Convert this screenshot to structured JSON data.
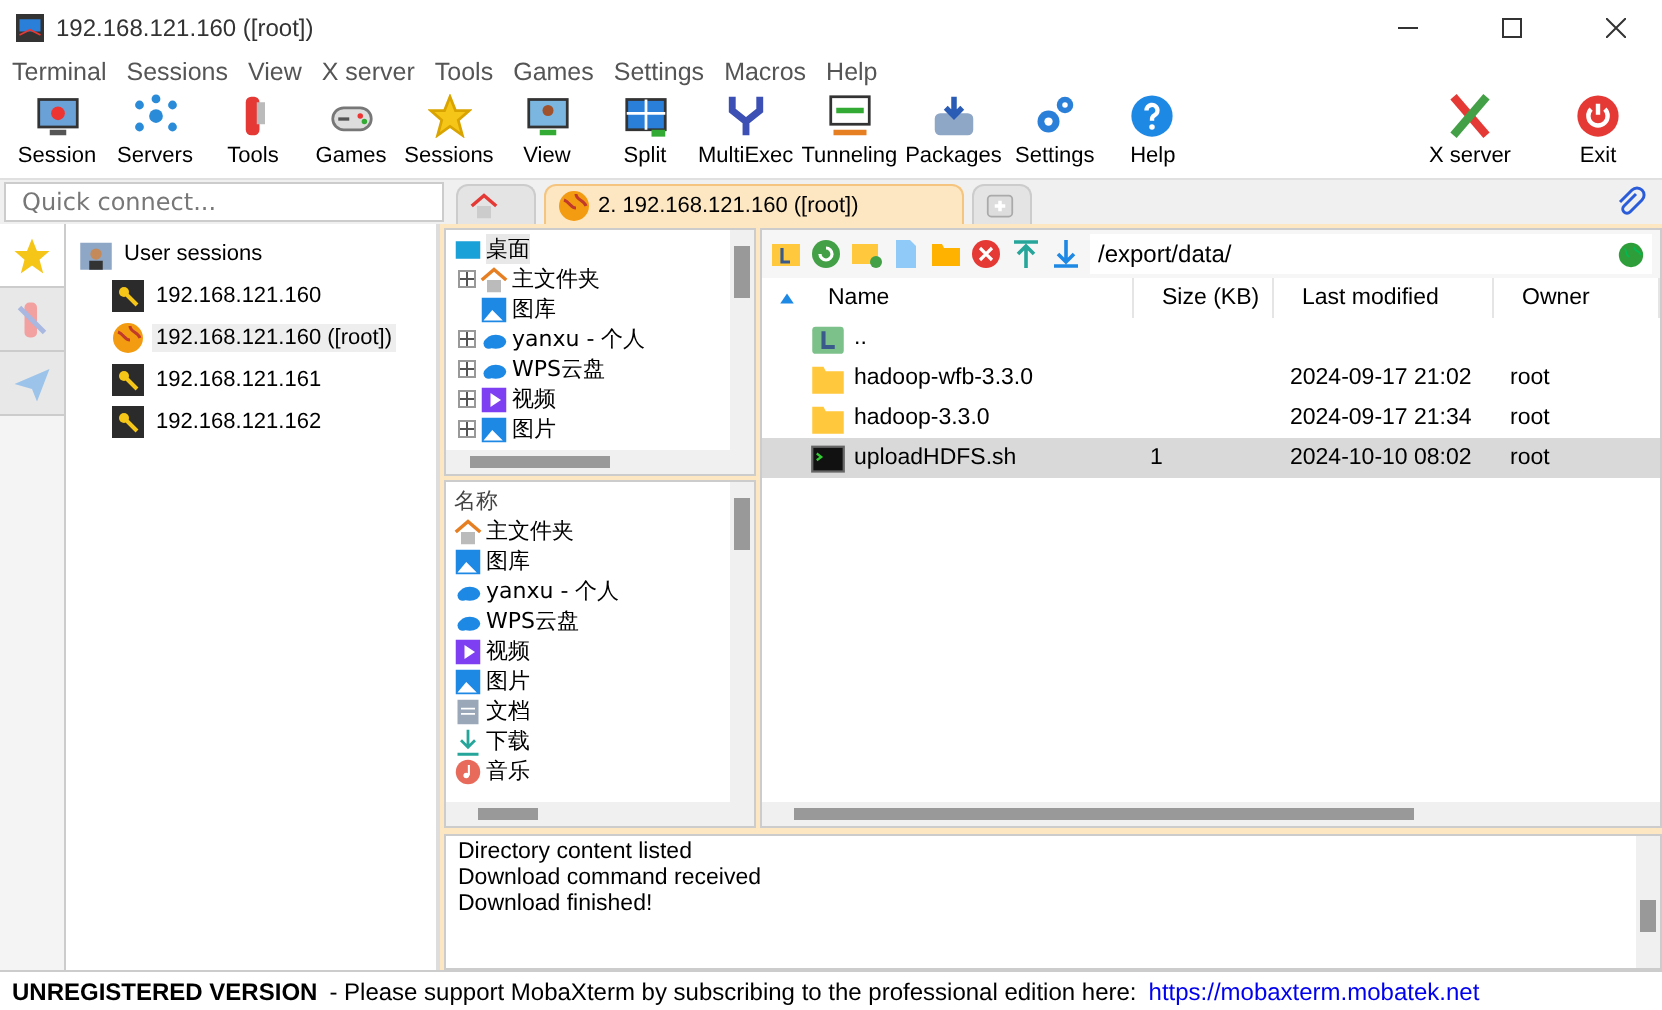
{
  "window": {
    "title": "192.168.121.160 ([root])"
  },
  "menu": [
    "Terminal",
    "Sessions",
    "View",
    "X server",
    "Tools",
    "Games",
    "Settings",
    "Macros",
    "Help"
  ],
  "toolbar": {
    "main": [
      "Session",
      "Servers",
      "Tools",
      "Games",
      "Sessions",
      "View",
      "Split",
      "MultiExec",
      "Tunneling",
      "Packages",
      "Settings",
      "Help"
    ],
    "right": [
      "X server",
      "Exit"
    ]
  },
  "quick_connect": {
    "placeholder": "Quick connect..."
  },
  "side_tabs": [
    {
      "kind": "star",
      "selected": true
    },
    {
      "kind": "tools",
      "selected": false
    },
    {
      "kind": "send",
      "selected": false
    }
  ],
  "sessions": {
    "label": "User sessions",
    "children": [
      {
        "label": "192.168.121.160",
        "kind": "ssh",
        "selected": false
      },
      {
        "label": "192.168.121.160 ([root])",
        "kind": "sftp",
        "selected": true
      },
      {
        "label": "192.168.121.161",
        "kind": "ssh",
        "selected": false
      },
      {
        "label": "192.168.121.162",
        "kind": "ssh",
        "selected": false
      }
    ]
  },
  "tabs": [
    {
      "kind": "home",
      "selected": false
    },
    {
      "kind": "session",
      "label": "2. 192.168.121.160 ([root])",
      "selected": true
    },
    {
      "kind": "new",
      "selected": false
    }
  ],
  "folder_tree": {
    "label": "桌面",
    "selected": true,
    "children": [
      {
        "label": "主文件夹",
        "kind": "home",
        "expandable": true,
        "selected": false
      },
      {
        "label": "图库",
        "kind": "image",
        "expandable": false,
        "selected": false
      },
      {
        "label": "yanxu - 个人",
        "kind": "cloud",
        "expandable": true,
        "selected": false
      },
      {
        "label": "WPS云盘",
        "kind": "cloud",
        "expandable": true,
        "selected": false
      },
      {
        "label": "视频",
        "kind": "video",
        "expandable": true,
        "selected": false
      },
      {
        "label": "图片",
        "kind": "image",
        "expandable": true,
        "selected": false
      }
    ]
  },
  "folder_list": {
    "header": "名称",
    "items": [
      {
        "label": "主文件夹",
        "kind": "home"
      },
      {
        "label": "图库",
        "kind": "image"
      },
      {
        "label": "yanxu - 个人",
        "kind": "cloud"
      },
      {
        "label": "WPS云盘",
        "kind": "cloud"
      },
      {
        "label": "视频",
        "kind": "video"
      },
      {
        "label": "图片",
        "kind": "image"
      },
      {
        "label": "文档",
        "kind": "doc"
      },
      {
        "label": "下载",
        "kind": "download"
      },
      {
        "label": "音乐",
        "kind": "music"
      }
    ]
  },
  "file_browser": {
    "path": "/export/data/",
    "columns": [
      {
        "label": "Name",
        "sorted": true
      },
      {
        "label": "Size (KB)",
        "sorted": false
      },
      {
        "label": "Last modified",
        "sorted": false
      },
      {
        "label": "Owner",
        "sorted": false
      }
    ],
    "rows": [
      {
        "kind": "parent",
        "name": "..",
        "selected": false
      },
      {
        "kind": "folder",
        "name": "hadoop-wfb-3.3.0",
        "modified": "2024-09-17 21:02",
        "owner": "root",
        "selected": false
      },
      {
        "kind": "folder",
        "name": "hadoop-3.3.0",
        "modified": "2024-09-17 21:34",
        "owner": "root",
        "selected": false
      },
      {
        "kind": "script",
        "name": "uploadHDFS.sh",
        "size": "1",
        "modified": "2024-10-10 08:02",
        "owner": "root",
        "selected": true
      }
    ]
  },
  "log": [
    "Directory content listed",
    "Download command received",
    "Download finished!"
  ],
  "status_bar": {
    "title": "UNREGISTERED VERSION",
    "message": "-  Please support MobaXterm by subscribing to the professional edition here:",
    "link": "https://mobaxterm.mobatek.net"
  }
}
